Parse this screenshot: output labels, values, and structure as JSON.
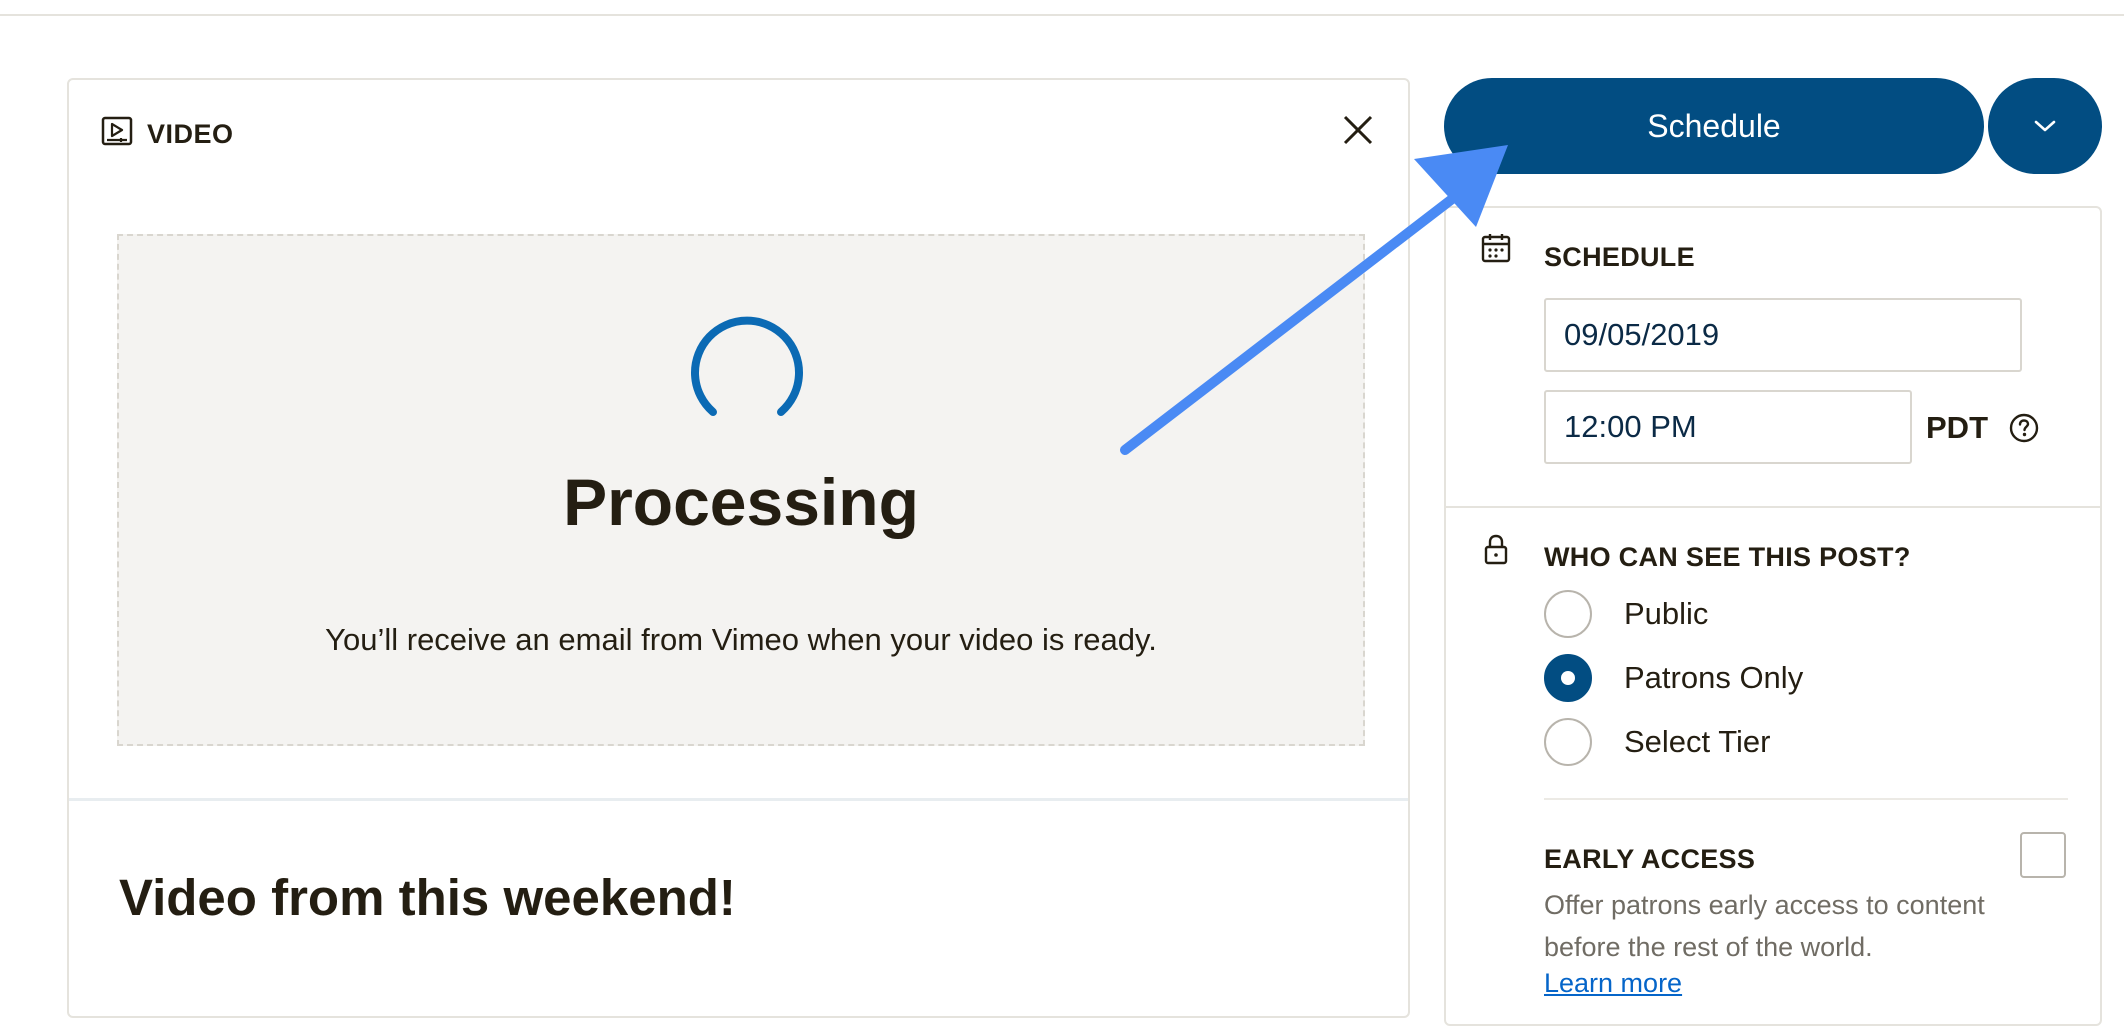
{
  "video_card": {
    "header_title": "VIDEO",
    "processing_title": "Processing",
    "processing_message": "You’ll receive an email from Vimeo when your video is ready.",
    "post_title": "Video from this weekend!"
  },
  "actions": {
    "schedule_label": "Schedule"
  },
  "schedule": {
    "section_label": "SCHEDULE",
    "date_value": "09/05/2019",
    "time_value": "12:00 PM",
    "timezone": "PDT"
  },
  "visibility": {
    "section_label": "WHO CAN SEE THIS POST?",
    "options": [
      {
        "label": "Public",
        "selected": false
      },
      {
        "label": "Patrons Only",
        "selected": true
      },
      {
        "label": "Select Tier",
        "selected": false
      }
    ]
  },
  "early_access": {
    "label": "EARLY ACCESS",
    "checked": false,
    "description": "Offer patrons early access to content before the rest of the world.",
    "learn_more": "Learn more"
  },
  "colors": {
    "primary": "#024d82",
    "annotation_arrow": "#4a8af4",
    "link": "#0565c9"
  },
  "icons": [
    "video-icon",
    "close-icon",
    "chevron-down-icon",
    "calendar-icon",
    "help-icon",
    "lock-icon",
    "spinner-icon"
  ]
}
